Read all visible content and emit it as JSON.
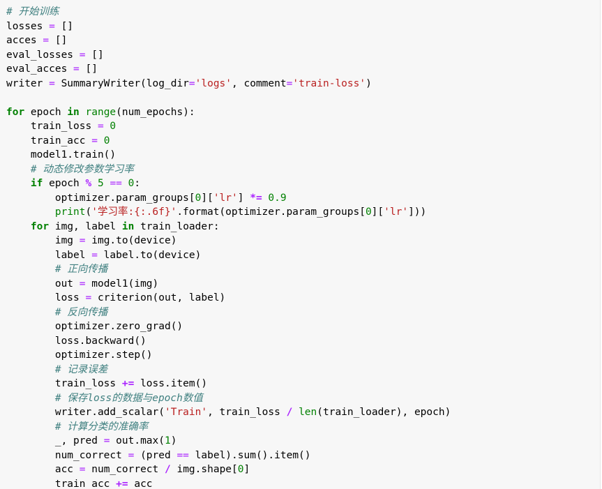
{
  "editor": {
    "language": "python",
    "colors": {
      "background": "#f7f7f7",
      "keyword": "#008000",
      "comment": "#408080",
      "string": "#ba2121",
      "number": "#008000",
      "operator": "#aa22ff",
      "text": "#000000"
    },
    "lines": [
      [
        [
          "cm",
          "# 开始训练"
        ]
      ],
      [
        [
          "p",
          "losses "
        ],
        [
          "o",
          "="
        ],
        [
          "p",
          " []"
        ]
      ],
      [
        [
          "p",
          "acces "
        ],
        [
          "o",
          "="
        ],
        [
          "p",
          " []"
        ]
      ],
      [
        [
          "p",
          "eval_losses "
        ],
        [
          "o",
          "="
        ],
        [
          "p",
          " []"
        ]
      ],
      [
        [
          "p",
          "eval_acces "
        ],
        [
          "o",
          "="
        ],
        [
          "p",
          " []"
        ]
      ],
      [
        [
          "p",
          "writer "
        ],
        [
          "o",
          "="
        ],
        [
          "p",
          " SummaryWriter(log_dir"
        ],
        [
          "o",
          "="
        ],
        [
          "str",
          "'logs'"
        ],
        [
          "p",
          ", comment"
        ],
        [
          "o",
          "="
        ],
        [
          "str",
          "'train-loss'"
        ],
        [
          "p",
          ")"
        ]
      ],
      [],
      [
        [
          "kw",
          "for"
        ],
        [
          "p",
          " epoch "
        ],
        [
          "kw",
          "in"
        ],
        [
          "p",
          " "
        ],
        [
          "bi",
          "range"
        ],
        [
          "p",
          "(num_epochs):"
        ]
      ],
      [
        [
          "p",
          "    train_loss "
        ],
        [
          "o",
          "="
        ],
        [
          "p",
          " "
        ],
        [
          "num",
          "0"
        ]
      ],
      [
        [
          "p",
          "    train_acc "
        ],
        [
          "o",
          "="
        ],
        [
          "p",
          " "
        ],
        [
          "num",
          "0"
        ]
      ],
      [
        [
          "p",
          "    model1.train()"
        ]
      ],
      [
        [
          "p",
          "    "
        ],
        [
          "cm",
          "# 动态修改参数学习率"
        ]
      ],
      [
        [
          "p",
          "    "
        ],
        [
          "kw",
          "if"
        ],
        [
          "p",
          " epoch "
        ],
        [
          "op",
          "%"
        ],
        [
          "p",
          " "
        ],
        [
          "num",
          "5"
        ],
        [
          "p",
          " "
        ],
        [
          "o",
          "=="
        ],
        [
          "p",
          " "
        ],
        [
          "num",
          "0"
        ],
        [
          "p",
          ":"
        ]
      ],
      [
        [
          "p",
          "        optimizer.param_groups["
        ],
        [
          "num",
          "0"
        ],
        [
          "p",
          "]["
        ],
        [
          "str",
          "'lr'"
        ],
        [
          "p",
          "] "
        ],
        [
          "op",
          "*="
        ],
        [
          "p",
          " "
        ],
        [
          "num",
          "0.9"
        ]
      ],
      [
        [
          "p",
          "        "
        ],
        [
          "bi",
          "print"
        ],
        [
          "p",
          "("
        ],
        [
          "str",
          "'学习率:{:.6f}'"
        ],
        [
          "p",
          ".format(optimizer.param_groups["
        ],
        [
          "num",
          "0"
        ],
        [
          "p",
          "]["
        ],
        [
          "str",
          "'lr'"
        ],
        [
          "p",
          "]))"
        ]
      ],
      [
        [
          "p",
          "    "
        ],
        [
          "kw",
          "for"
        ],
        [
          "p",
          " img, label "
        ],
        [
          "kw",
          "in"
        ],
        [
          "p",
          " train_loader:"
        ]
      ],
      [
        [
          "p",
          "        img "
        ],
        [
          "o",
          "="
        ],
        [
          "p",
          " img.to(device)"
        ]
      ],
      [
        [
          "p",
          "        label "
        ],
        [
          "o",
          "="
        ],
        [
          "p",
          " label.to(device)"
        ]
      ],
      [
        [
          "p",
          "        "
        ],
        [
          "cm",
          "# 正向传播"
        ]
      ],
      [
        [
          "p",
          "        out "
        ],
        [
          "o",
          "="
        ],
        [
          "p",
          " model1(img)"
        ]
      ],
      [
        [
          "p",
          "        loss "
        ],
        [
          "o",
          "="
        ],
        [
          "p",
          " criterion(out, label)"
        ]
      ],
      [
        [
          "p",
          "        "
        ],
        [
          "cm",
          "# 反向传播"
        ]
      ],
      [
        [
          "p",
          "        optimizer.zero_grad()"
        ]
      ],
      [
        [
          "p",
          "        loss.backward()"
        ]
      ],
      [
        [
          "p",
          "        optimizer.step()"
        ]
      ],
      [
        [
          "p",
          "        "
        ],
        [
          "cm",
          "# 记录误差"
        ]
      ],
      [
        [
          "p",
          "        train_loss "
        ],
        [
          "op",
          "+="
        ],
        [
          "p",
          " loss.item()"
        ]
      ],
      [
        [
          "p",
          "        "
        ],
        [
          "cm",
          "# 保存loss的数据与epoch数值"
        ]
      ],
      [
        [
          "p",
          "        writer.add_scalar("
        ],
        [
          "str",
          "'Train'"
        ],
        [
          "p",
          ", train_loss "
        ],
        [
          "op",
          "/"
        ],
        [
          "p",
          " "
        ],
        [
          "bi",
          "len"
        ],
        [
          "p",
          "(train_loader), epoch)"
        ]
      ],
      [
        [
          "p",
          "        "
        ],
        [
          "cm",
          "# 计算分类的准确率"
        ]
      ],
      [
        [
          "p",
          "        _, pred "
        ],
        [
          "o",
          "="
        ],
        [
          "p",
          " out.max("
        ],
        [
          "num",
          "1"
        ],
        [
          "p",
          ")"
        ]
      ],
      [
        [
          "p",
          "        num_correct "
        ],
        [
          "o",
          "="
        ],
        [
          "p",
          " (pred "
        ],
        [
          "o",
          "=="
        ],
        [
          "p",
          " label).sum().item()"
        ]
      ],
      [
        [
          "p",
          "        acc "
        ],
        [
          "o",
          "="
        ],
        [
          "p",
          " num_correct "
        ],
        [
          "op",
          "/"
        ],
        [
          "p",
          " img.shape["
        ],
        [
          "num",
          "0"
        ],
        [
          "p",
          "]"
        ]
      ],
      [
        [
          "p",
          "        train_acc "
        ],
        [
          "op",
          "+="
        ],
        [
          "p",
          " acc"
        ]
      ]
    ]
  }
}
